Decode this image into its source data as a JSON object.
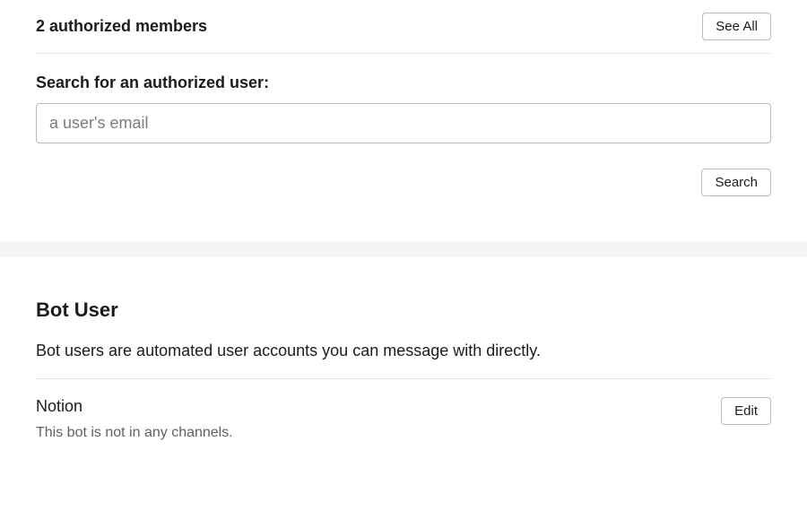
{
  "members": {
    "heading": "2 authorized members",
    "see_all_label": "See All"
  },
  "search": {
    "label": "Search for an authorized user:",
    "placeholder": "a user's email",
    "button_label": "Search"
  },
  "bot_user": {
    "title": "Bot User",
    "description": "Bot users are automated user accounts you can message with directly.",
    "name": "Notion",
    "status": "This bot is not in any channels.",
    "edit_label": "Edit"
  }
}
